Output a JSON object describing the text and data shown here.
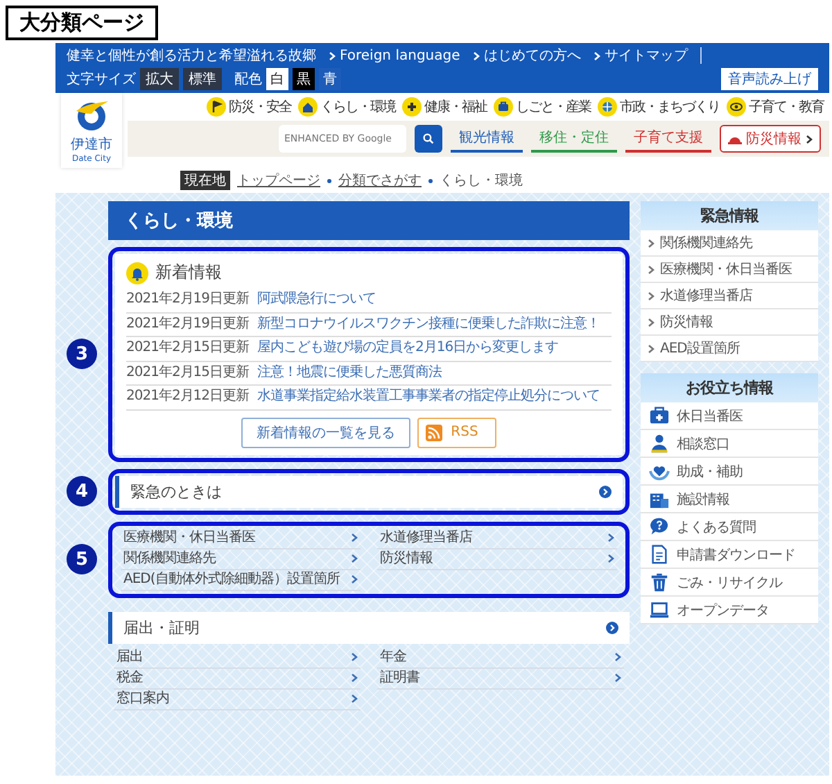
{
  "page_label": "大分類ページ",
  "top_bar": {
    "slogan": "健幸と個性が創る活力と希望溢れる故郷",
    "links": [
      "Foreign language",
      "はじめての方へ",
      "サイトマップ"
    ],
    "font_size": {
      "label": "文字サイズ",
      "buttons": [
        "拡大",
        "標準"
      ]
    },
    "color_scheme": {
      "label": "配色",
      "options": [
        {
          "label": "白",
          "kind": "white"
        },
        {
          "label": "黒",
          "kind": "black"
        },
        {
          "label": "青",
          "kind": "blue"
        }
      ]
    },
    "read_aloud": "音声読み上げ"
  },
  "logo": {
    "name": "伊達市",
    "subtitle": "Date City"
  },
  "nav": [
    "防災・安全",
    "くらし・環境",
    "健康・福祉",
    "しごと・産業",
    "市政・まちづくり",
    "子育て・教育"
  ],
  "search": {
    "placeholder": "ENHANCED BY Google"
  },
  "quick_tabs": [
    {
      "label": "観光情報",
      "color": "#1d5cb8"
    },
    {
      "label": "移住・定住",
      "color": "#2e9a4a"
    },
    {
      "label": "子育て支援",
      "color": "#d03030"
    }
  ],
  "disaster_button": "防災情報",
  "breadcrumb": {
    "label": "現在地",
    "items": [
      "トップページ",
      "分類でさがす",
      "くらし・環境"
    ]
  },
  "page_title": "くらし・環境",
  "news": {
    "marker": "3",
    "title": "新着情報",
    "items": [
      {
        "date": "2021年2月19日更新",
        "title": "阿武隈急行について"
      },
      {
        "date": "2021年2月19日更新",
        "title": "新型コロナウイルスワクチン接種に便乗した詐欺に注意！"
      },
      {
        "date": "2021年2月15日更新",
        "title": "屋内こども遊び場の定員を2月16日から変更します"
      },
      {
        "date": "2021年2月15日更新",
        "title": "注意！地震に便乗した悪質商法"
      },
      {
        "date": "2021年2月12日更新",
        "title": "水道事業指定給水装置工事事業者の指定停止処分について"
      }
    ],
    "list_button": "新着情報の一覧を見る",
    "rss_button": "RSS"
  },
  "emergency": {
    "marker": "4",
    "title": "緊急のときは"
  },
  "emergency_links": {
    "marker": "5",
    "items": [
      "医療機関・休日当番医",
      "水道修理当番店",
      "関係機関連絡先",
      "防災情報",
      "AED(自動体外式除細動器）設置箇所"
    ]
  },
  "notifications": {
    "title": "届出・証明",
    "items": [
      "届出",
      "年金",
      "税金",
      "証明書",
      "窓口案内"
    ]
  },
  "sidebar": {
    "emergency": {
      "title": "緊急情報",
      "items": [
        "関係機関連絡先",
        "医療機関・休日当番医",
        "水道修理当番店",
        "防災情報",
        "AED設置箇所"
      ]
    },
    "useful": {
      "title": "お役立ち情報",
      "items": [
        "休日当番医",
        "相談窓口",
        "助成・補助",
        "施設情報",
        "よくある質問",
        "申請書ダウンロード",
        "ごみ・リサイクル",
        "オープンデータ"
      ]
    }
  }
}
